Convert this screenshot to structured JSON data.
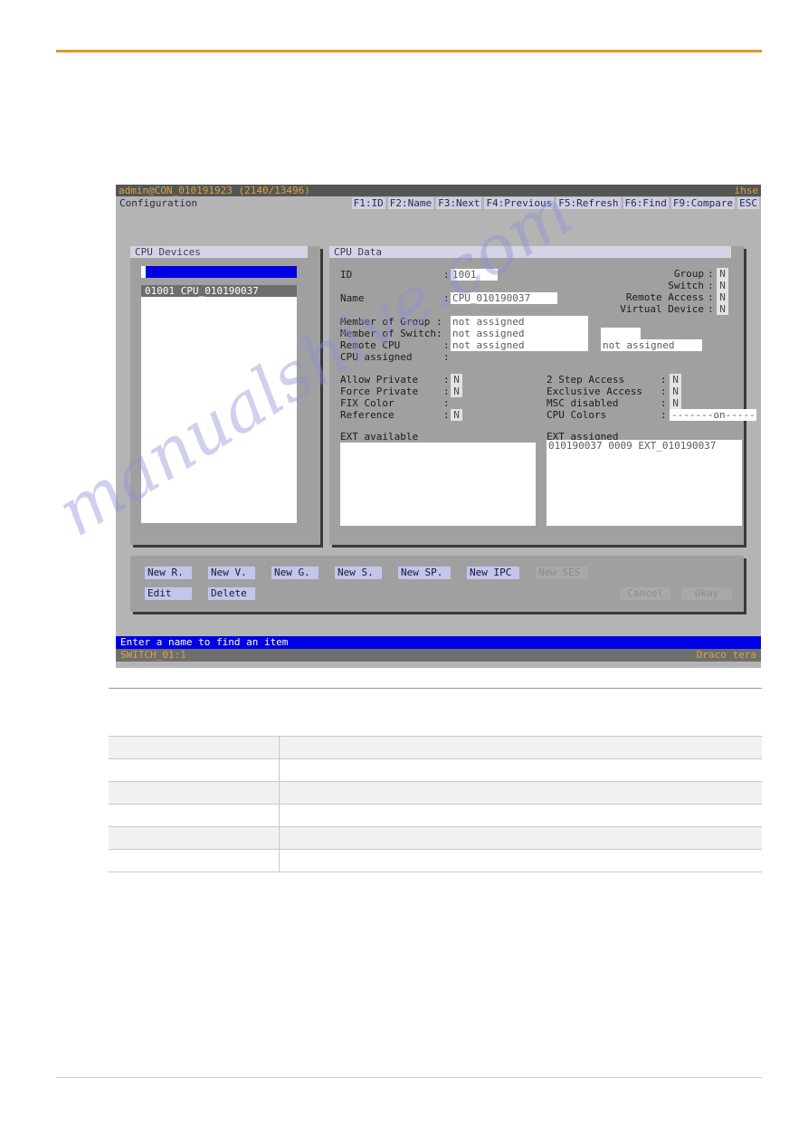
{
  "window": {
    "title_left": "admin@CON_010191923 (2140/13496)",
    "title_right": "ihse",
    "menu_title": "Configuration",
    "menu_keys": [
      "F1:ID",
      "F2:Name",
      "F3:Next",
      "F4:Previous",
      "F5:Refresh",
      "F6:Find",
      "F9:Compare",
      "ESC"
    ]
  },
  "devices_panel": {
    "title": "CPU Devices",
    "search_value": "",
    "items": [
      "01001 CPU_010190037"
    ]
  },
  "cpu_data": {
    "title": "CPU Data",
    "id_label": "ID",
    "id_value": "1001",
    "name_label": "Name",
    "name_value": "CPU_010190037",
    "member_of_group_label": "Member of Group :",
    "member_of_group_value": "not assigned",
    "member_of_switch_label": "Member of Switch:",
    "member_of_switch_value": "not assigned",
    "remote_cpu_label": "Remote CPU",
    "remote_cpu_value": "not assigned",
    "cpu_assigned_label": "CPU assigned",
    "cpu_assigned_value": "",
    "side_extra_empty": "",
    "side_extra_value": "not assigned",
    "flags_right": [
      {
        "label": "Group",
        "value": "N"
      },
      {
        "label": "Switch",
        "value": "N"
      },
      {
        "label": "Remote Access",
        "value": "N"
      },
      {
        "label": "Virtual Device",
        "value": "N"
      }
    ],
    "options_left": [
      {
        "label": "Allow Private",
        "value": "N"
      },
      {
        "label": "Force Private",
        "value": "N"
      },
      {
        "label": "FIX Color",
        "value": ""
      },
      {
        "label": "Reference",
        "value": "N"
      }
    ],
    "options_right": [
      {
        "label": "2 Step Access",
        "value": "N"
      },
      {
        "label": "Exclusive Access",
        "value": "N"
      },
      {
        "label": "MSC disabled",
        "value": "N"
      },
      {
        "label": "CPU Colors",
        "value": "-------on------"
      }
    ],
    "ext_available_label": "EXT available",
    "ext_available_items": [],
    "ext_assigned_label": "EXT assigned",
    "ext_assigned_items": [
      "010190037 0009 EXT_010190037"
    ]
  },
  "buttons": {
    "row1": [
      {
        "label": "New R.",
        "enabled": true
      },
      {
        "label": "New V.",
        "enabled": true
      },
      {
        "label": "New G.",
        "enabled": true
      },
      {
        "label": "New S.",
        "enabled": true
      },
      {
        "label": "New SP.",
        "enabled": true
      },
      {
        "label": "New IPC",
        "enabled": true
      },
      {
        "label": "New SES",
        "enabled": false
      }
    ],
    "row2_left": [
      {
        "label": "Edit",
        "enabled": true
      },
      {
        "label": "Delete",
        "enabled": true
      }
    ],
    "row2_right": [
      {
        "label": "Cancel",
        "enabled": false
      },
      {
        "label": "Okay",
        "enabled": false
      }
    ]
  },
  "status": {
    "message": "Enter a name to find an item",
    "footer_left": "SWITCH_01:1",
    "footer_right": "Draco tera"
  },
  "watermark": {
    "text": "manualshive.com"
  },
  "doc_table": {
    "rows": [
      {
        "col1": "",
        "col2": "",
        "shaded": false
      },
      {
        "col1": "",
        "col2": "",
        "shaded": true
      },
      {
        "col1": "",
        "col2": "",
        "shaded": false
      },
      {
        "col1": "",
        "col2": "",
        "shaded": true
      },
      {
        "col1": "",
        "col2": "",
        "shaded": false
      },
      {
        "col1": "",
        "col2": "",
        "shaded": true
      },
      {
        "col1": "",
        "col2": "",
        "shaded": false
      }
    ]
  },
  "colors": {
    "accent_rule": "#d79b28",
    "window_bg": "#b4b4b4",
    "panel_bg": "#a0a0a0",
    "title_bar_bg": "#555555",
    "title_text": "#d8a441",
    "status_bg": "#0000e6",
    "button_bg": "#c4c4ec",
    "selection_bg": "#0000e0"
  }
}
